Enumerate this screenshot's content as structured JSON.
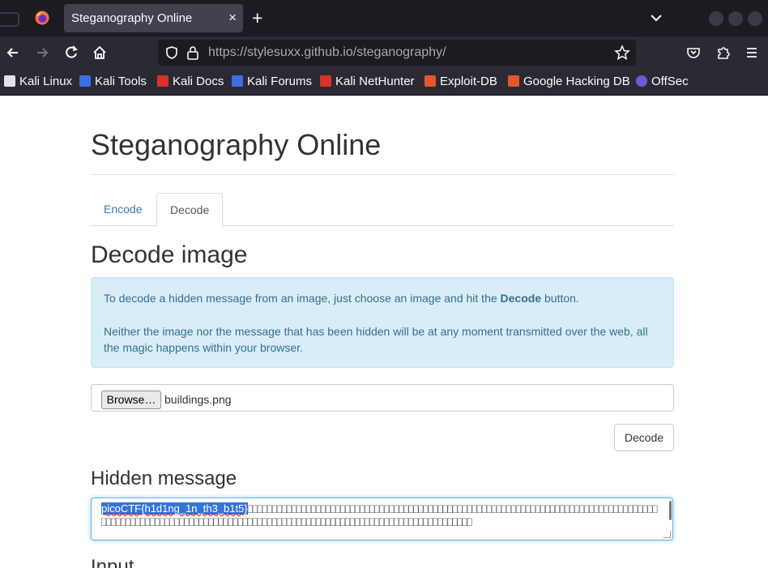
{
  "browser": {
    "tab_title": "Steganography Online",
    "tab_close": "×",
    "new_tab": "+",
    "url_host": "https://stylesuxx.github.io",
    "url_path": "/steganography/"
  },
  "bookmarks": [
    {
      "label": "Kali Linux",
      "icon": "kali-dragon-icon",
      "color": "#ffffff"
    },
    {
      "label": "Kali Tools",
      "icon": "kali-tools-icon",
      "color": "#3d6ee8"
    },
    {
      "label": "Kali Docs",
      "icon": "kali-docs-icon",
      "color": "#d9322b"
    },
    {
      "label": "Kali Forums",
      "icon": "kali-forums-icon",
      "color": "#3d6ee8"
    },
    {
      "label": "Kali NetHunter",
      "icon": "kali-nethunter-icon",
      "color": "#d9322b"
    },
    {
      "label": "Exploit-DB",
      "icon": "exploit-db-icon",
      "color": "#e2582a"
    },
    {
      "label": "Google Hacking DB",
      "icon": "ghdb-icon",
      "color": "#e2582a"
    },
    {
      "label": "OffSec",
      "icon": "offsec-icon",
      "color": "#6b5bd8"
    }
  ],
  "page": {
    "title": "Steganography Online",
    "tabs": {
      "encode": "Encode",
      "decode": "Decode"
    },
    "section_title": "Decode image",
    "info_text_1a": "To decode a hidden message from an image, just choose an image and hit the ",
    "info_bold": "Decode",
    "info_text_1b": " button.",
    "info_text_2": "Neither the image nor the message that has been hidden will be at any moment transmitted over the web, all the magic happens within your browser.",
    "browse_label": "Browse…",
    "file_name": "buildings.png",
    "decode_button": "Decode",
    "hidden_title": "Hidden message",
    "hidden_message": "picoCTF{h1d1ng_1n_th3_b1t5}",
    "next_section": "Input"
  },
  "colors": {
    "link": "#337ab7",
    "alert_bg": "#d9edf7",
    "alert_text": "#31708f",
    "selection": "#3574d4"
  }
}
